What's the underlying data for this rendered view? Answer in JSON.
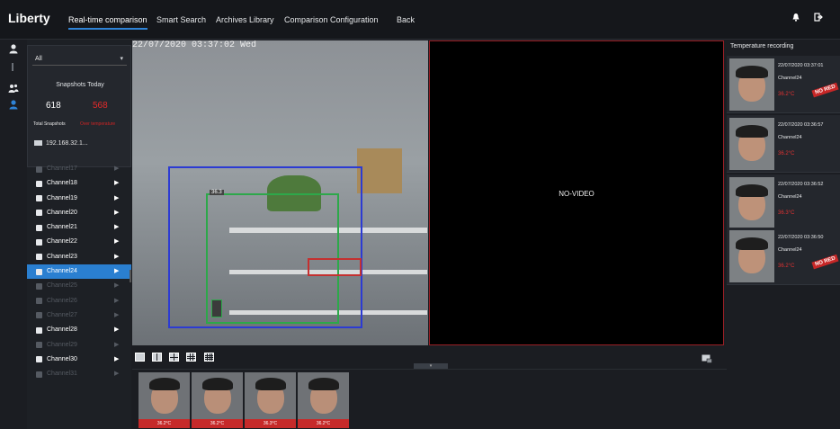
{
  "app": {
    "logo": "Liberty"
  },
  "nav": {
    "items": [
      "Real-time comparison",
      "Smart Search",
      "Archives Library",
      "Comparison Configuration",
      "Back"
    ]
  },
  "topbar_icons": [
    "bell-icon",
    "logout-icon"
  ],
  "rail_icons": [
    "user-icon",
    "people-icon",
    "face-icon"
  ],
  "snapshots": {
    "select_value": "All",
    "title": "Snapshots Today",
    "total": "618",
    "over": "568",
    "total_label": "Total Snapshots",
    "over_label": "Over temperature"
  },
  "device": {
    "label": "192.168.32.1..."
  },
  "channels": [
    {
      "label": "Channel17",
      "state": "off"
    },
    {
      "label": "Channel18",
      "state": "on"
    },
    {
      "label": "Channel19",
      "state": "on"
    },
    {
      "label": "Channel20",
      "state": "on"
    },
    {
      "label": "Channel21",
      "state": "on"
    },
    {
      "label": "Channel22",
      "state": "on"
    },
    {
      "label": "Channel23",
      "state": "on"
    },
    {
      "label": "Channel24",
      "state": "selected"
    },
    {
      "label": "Channel25",
      "state": "off"
    },
    {
      "label": "Channel26",
      "state": "off"
    },
    {
      "label": "Channel27",
      "state": "off"
    },
    {
      "label": "Channel28",
      "state": "on"
    },
    {
      "label": "Channel29",
      "state": "off"
    },
    {
      "label": "Channel30",
      "state": "on"
    },
    {
      "label": "Channel31",
      "state": "off"
    }
  ],
  "video_main": {
    "osd": "22/07/2020 03:37:02 Wed",
    "face_tag": "36.3"
  },
  "video_secondary": {
    "label": "NO-VIDEO"
  },
  "thumbnails": [
    {
      "temp": "36.2°C"
    },
    {
      "temp": "36.2°C"
    },
    {
      "temp": "36.3°C"
    },
    {
      "temp": "36.2°C"
    }
  ],
  "records": {
    "title": "Temperature recording",
    "items": [
      {
        "time": "22/07/2020 03:37:01",
        "channel": "Channel24",
        "temp": "36.2°C",
        "alarm": true
      },
      {
        "time": "22/07/2020 03:36:57",
        "channel": "Channel24",
        "temp": "36.2°C",
        "alarm": false
      },
      {
        "time": "22/07/2020 03:36:52",
        "channel": "Channel24",
        "temp": "36.3°C",
        "alarm": false
      },
      {
        "time": "22/07/2020 03:36:50",
        "channel": "Channel24",
        "temp": "36.2°C",
        "alarm": true
      }
    ],
    "alarm_label": "NO RED"
  },
  "colors": {
    "accent": "#2f83d6",
    "alarm": "#c72727",
    "background": "#1b1d22"
  }
}
